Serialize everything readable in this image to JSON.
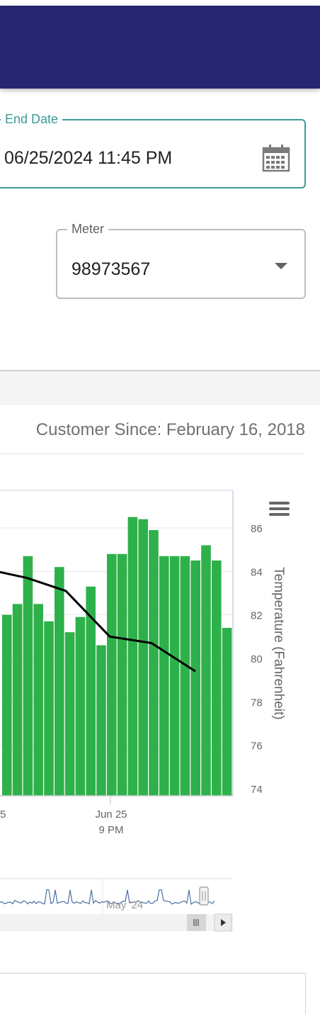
{
  "header": {
    "background": "#262770"
  },
  "end_date": {
    "label": "End Date",
    "value": "06/25/2024 11:45 PM",
    "icon": "calendar-icon",
    "accent": "#3d9a96"
  },
  "meter": {
    "label": "Meter",
    "value": "98973567",
    "icon": "dropdown-arrow-icon"
  },
  "customer": {
    "since": "Customer Since: February 16, 2018"
  },
  "chart_menu": {
    "icon": "hamburger-menu-icon"
  },
  "chart_data": {
    "type": "bar",
    "x_tick_labels": [
      "5",
      "Jun 25\n9 PM"
    ],
    "bar_color": "#2eb14a",
    "line_color": "#000000",
    "bar_values": [
      82.0,
      82.5,
      84.7,
      82.5,
      81.7,
      84.2,
      81.2,
      81.9,
      83.3,
      80.6,
      84.8,
      84.8,
      86.5,
      86.4,
      85.9,
      84.7,
      84.7,
      84.7,
      84.5,
      85.2,
      84.5,
      81.4
    ],
    "temperature_line": [
      84.0,
      83.7,
      83.1,
      81.0,
      80.7,
      79.4
    ],
    "y_right": {
      "label": "Temperature (Fahrenheit)",
      "ticks": [
        86,
        84,
        82,
        80,
        78,
        76,
        74
      ],
      "min": 74,
      "max": 86
    },
    "navigator": {
      "label": "May '24"
    },
    "colors": {
      "navigator_line": "#4a6fa5",
      "plot_border": "#c7d4e6"
    }
  }
}
